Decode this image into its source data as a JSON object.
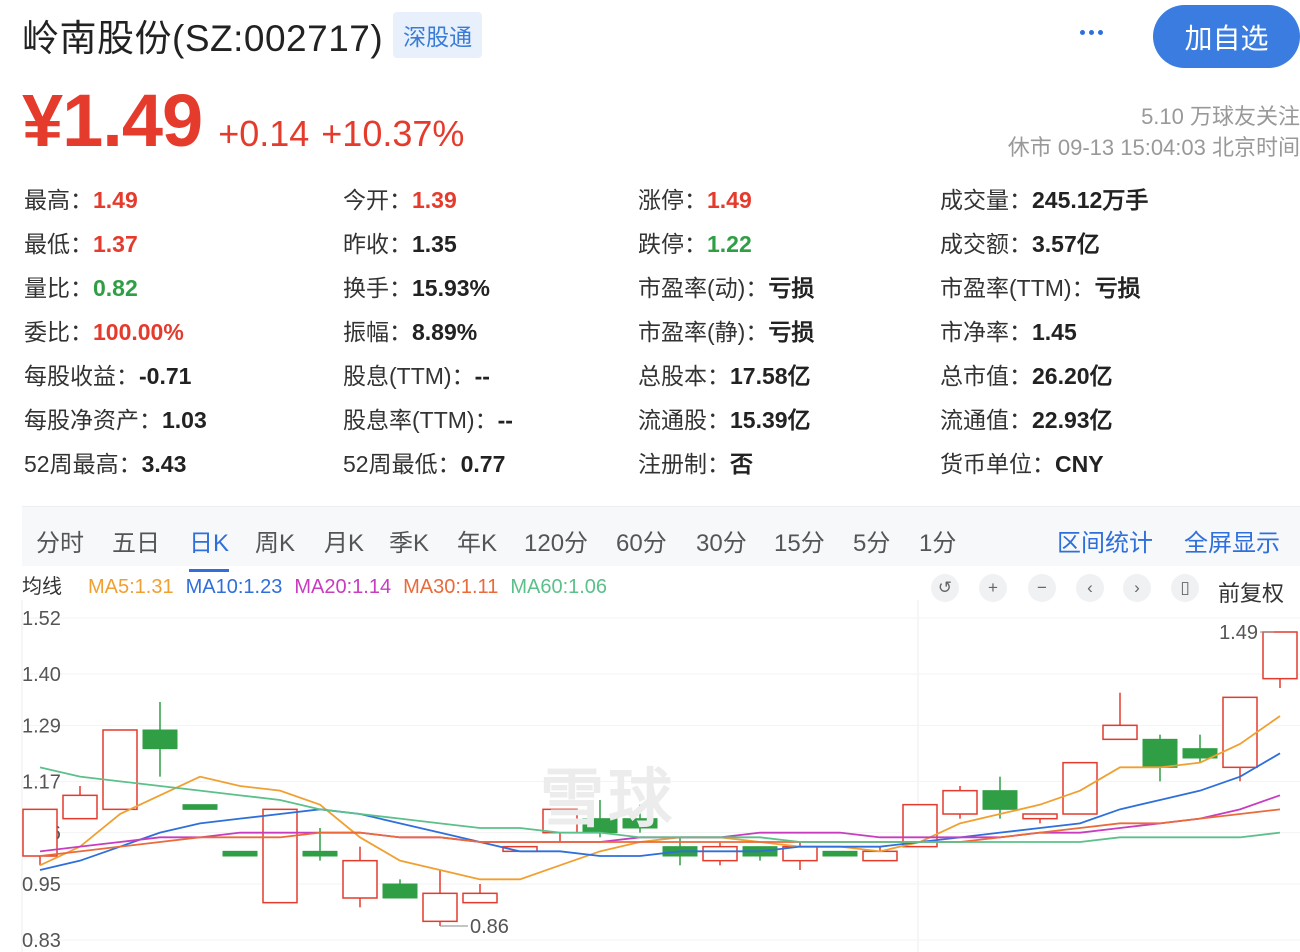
{
  "header": {
    "title": "岭南股份(SZ:002717)",
    "tag": "深股通",
    "follow_label": "加自选"
  },
  "quote": {
    "price": "¥1.49",
    "change": "+0.14",
    "change_pct": "+10.37%",
    "followers": "5.10 万球友关注",
    "status": "休市 09-13 15:04:03 北京时间"
  },
  "stats": [
    [
      {
        "k": "最高：",
        "v": "1.49",
        "c": "red"
      },
      {
        "k": "今开：",
        "v": "1.39",
        "c": "red"
      },
      {
        "k": "涨停：",
        "v": "1.49",
        "c": "red"
      },
      {
        "k": "成交量：",
        "v": "245.12万手",
        "c": "dark"
      }
    ],
    [
      {
        "k": "最低：",
        "v": "1.37",
        "c": "red"
      },
      {
        "k": "昨收：",
        "v": "1.35",
        "c": "dark"
      },
      {
        "k": "跌停：",
        "v": "1.22",
        "c": "green"
      },
      {
        "k": "成交额：",
        "v": "3.57亿",
        "c": "dark"
      }
    ],
    [
      {
        "k": "量比：",
        "v": "0.82",
        "c": "green"
      },
      {
        "k": "换手：",
        "v": "15.93%",
        "c": "dark"
      },
      {
        "k": "市盈率(动)：",
        "v": "亏损",
        "c": "dark"
      },
      {
        "k": "市盈率(TTM)：",
        "v": "亏损",
        "c": "dark"
      }
    ],
    [
      {
        "k": "委比：",
        "v": "100.00%",
        "c": "red"
      },
      {
        "k": "振幅：",
        "v": "8.89%",
        "c": "dark"
      },
      {
        "k": "市盈率(静)：",
        "v": "亏损",
        "c": "dark"
      },
      {
        "k": "市净率：",
        "v": "1.45",
        "c": "dark"
      }
    ],
    [
      {
        "k": "每股收益：",
        "v": "-0.71",
        "c": "dark"
      },
      {
        "k": "股息(TTM)：",
        "v": "--",
        "c": "dark"
      },
      {
        "k": "总股本：",
        "v": "17.58亿",
        "c": "dark"
      },
      {
        "k": "总市值：",
        "v": "26.20亿",
        "c": "dark"
      }
    ],
    [
      {
        "k": "每股净资产：",
        "v": "1.03",
        "c": "dark"
      },
      {
        "k": "股息率(TTM)：",
        "v": "--",
        "c": "dark"
      },
      {
        "k": "流通股：",
        "v": "15.39亿",
        "c": "dark"
      },
      {
        "k": "流通值：",
        "v": "22.93亿",
        "c": "dark"
      }
    ],
    [
      {
        "k": "52周最高：",
        "v": "3.43",
        "c": "dark"
      },
      {
        "k": "52周最低：",
        "v": "0.77",
        "c": "dark"
      },
      {
        "k": "注册制：",
        "v": "否",
        "c": "dark"
      },
      {
        "k": "货币单位：",
        "v": "CNY",
        "c": "dark"
      }
    ]
  ],
  "tabs": [
    "分时",
    "五日",
    "日K",
    "周K",
    "月K",
    "季K",
    "年K",
    "120分",
    "60分",
    "30分",
    "15分",
    "5分",
    "1分"
  ],
  "active_tab": "日K",
  "tab_links": [
    "区间统计",
    "全屏显示"
  ],
  "ma_legend": {
    "label": "均线",
    "items": [
      {
        "text": "MA5:1.31",
        "color": "#f0a030"
      },
      {
        "text": "MA10:1.23",
        "color": "#2f6fdb"
      },
      {
        "text": "MA20:1.14",
        "color": "#c83cc0"
      },
      {
        "text": "MA30:1.11",
        "color": "#ea6a3a"
      },
      {
        "text": "MA60:1.06",
        "color": "#5cc08a"
      }
    ]
  },
  "controls": {
    "icons": [
      {
        "name": "undo-icon",
        "glyph": "↺"
      },
      {
        "name": "zoom-in-icon",
        "glyph": "+"
      },
      {
        "name": "zoom-out-icon",
        "glyph": "−"
      },
      {
        "name": "scroll-left-icon",
        "glyph": "‹"
      },
      {
        "name": "scroll-right-icon",
        "glyph": "›"
      },
      {
        "name": "candle-style-icon",
        "glyph": "▯"
      }
    ],
    "adjust_label": "前复权"
  },
  "chart_data": {
    "type": "candlestick",
    "watermark": "雪球",
    "ylim": [
      0.83,
      1.52
    ],
    "yticks": [
      1.52,
      1.4,
      1.29,
      1.17,
      1.06,
      0.95,
      0.83
    ],
    "ytick_labels": [
      "1.52",
      "1.40",
      "1.29",
      "1.17",
      "1.06",
      "0.95",
      "0.83"
    ],
    "max_label": "1.49",
    "min_label": "0.86",
    "up_color": "#e43b2d",
    "down_color": "#2f9e44",
    "candles": [
      {
        "o": 1.01,
        "h": 1.11,
        "l": 0.99,
        "c": 1.11
      },
      {
        "o": 1.09,
        "h": 1.16,
        "l": 1.09,
        "c": 1.14
      },
      {
        "o": 1.11,
        "h": 1.28,
        "l": 1.11,
        "c": 1.28
      },
      {
        "o": 1.28,
        "h": 1.34,
        "l": 1.18,
        "c": 1.24
      },
      {
        "o": 1.12,
        "h": 1.12,
        "l": 1.11,
        "c": 1.11
      },
      {
        "o": 1.02,
        "h": 1.02,
        "l": 1.01,
        "c": 1.01
      },
      {
        "o": 0.91,
        "h": 1.11,
        "l": 0.91,
        "c": 1.11
      },
      {
        "o": 1.02,
        "h": 1.07,
        "l": 1.0,
        "c": 1.01
      },
      {
        "o": 0.92,
        "h": 1.03,
        "l": 0.9,
        "c": 1.0
      },
      {
        "o": 0.95,
        "h": 0.96,
        "l": 0.92,
        "c": 0.92
      },
      {
        "o": 0.87,
        "h": 0.98,
        "l": 0.86,
        "c": 0.93
      },
      {
        "o": 0.91,
        "h": 0.95,
        "l": 0.91,
        "c": 0.93
      },
      {
        "o": 1.02,
        "h": 1.03,
        "l": 1.02,
        "c": 1.03
      },
      {
        "o": 1.06,
        "h": 1.11,
        "l": 1.04,
        "c": 1.11
      },
      {
        "o": 1.09,
        "h": 1.13,
        "l": 1.05,
        "c": 1.06
      },
      {
        "o": 1.09,
        "h": 1.12,
        "l": 1.06,
        "c": 1.07
      },
      {
        "o": 1.03,
        "h": 1.05,
        "l": 0.99,
        "c": 1.01
      },
      {
        "o": 1.0,
        "h": 1.04,
        "l": 0.99,
        "c": 1.03
      },
      {
        "o": 1.03,
        "h": 1.03,
        "l": 1.0,
        "c": 1.01
      },
      {
        "o": 1.0,
        "h": 1.04,
        "l": 0.98,
        "c": 1.03
      },
      {
        "o": 1.02,
        "h": 1.02,
        "l": 1.01,
        "c": 1.01
      },
      {
        "o": 1.0,
        "h": 1.03,
        "l": 1.0,
        "c": 1.02
      },
      {
        "o": 1.03,
        "h": 1.12,
        "l": 1.03,
        "c": 1.12
      },
      {
        "o": 1.1,
        "h": 1.16,
        "l": 1.09,
        "c": 1.15
      },
      {
        "o": 1.15,
        "h": 1.18,
        "l": 1.09,
        "c": 1.11
      },
      {
        "o": 1.09,
        "h": 1.1,
        "l": 1.08,
        "c": 1.1
      },
      {
        "o": 1.1,
        "h": 1.21,
        "l": 1.1,
        "c": 1.21
      },
      {
        "o": 1.26,
        "h": 1.36,
        "l": 1.26,
        "c": 1.29
      },
      {
        "o": 1.26,
        "h": 1.27,
        "l": 1.17,
        "c": 1.2
      },
      {
        "o": 1.24,
        "h": 1.27,
        "l": 1.21,
        "c": 1.22
      },
      {
        "o": 1.2,
        "h": 1.35,
        "l": 1.17,
        "c": 1.35
      },
      {
        "o": 1.39,
        "h": 1.49,
        "l": 1.37,
        "c": 1.49
      }
    ],
    "ma": [
      {
        "name": "MA5",
        "color": "#f0a030",
        "values": [
          0.99,
          1.03,
          1.1,
          1.14,
          1.18,
          1.16,
          1.15,
          1.12,
          1.05,
          1.0,
          0.98,
          0.96,
          0.96,
          0.99,
          1.02,
          1.04,
          1.05,
          1.05,
          1.04,
          1.03,
          1.03,
          1.02,
          1.04,
          1.08,
          1.1,
          1.12,
          1.15,
          1.2,
          1.2,
          1.21,
          1.25,
          1.31
        ]
      },
      {
        "name": "MA10",
        "color": "#2f6fdb",
        "values": [
          0.98,
          1.0,
          1.03,
          1.06,
          1.08,
          1.09,
          1.1,
          1.11,
          1.1,
          1.08,
          1.06,
          1.04,
          1.02,
          1.02,
          1.01,
          1.01,
          1.02,
          1.02,
          1.02,
          1.03,
          1.03,
          1.03,
          1.04,
          1.05,
          1.06,
          1.07,
          1.08,
          1.11,
          1.13,
          1.15,
          1.18,
          1.23
        ]
      },
      {
        "name": "MA20",
        "color": "#c83cc0",
        "values": [
          1.02,
          1.03,
          1.04,
          1.05,
          1.05,
          1.06,
          1.06,
          1.06,
          1.06,
          1.05,
          1.05,
          1.04,
          1.04,
          1.04,
          1.04,
          1.05,
          1.05,
          1.05,
          1.06,
          1.06,
          1.06,
          1.05,
          1.05,
          1.05,
          1.05,
          1.06,
          1.06,
          1.07,
          1.08,
          1.09,
          1.11,
          1.14
        ]
      },
      {
        "name": "MA30",
        "color": "#ea6a3a",
        "values": [
          1.01,
          1.02,
          1.03,
          1.04,
          1.05,
          1.05,
          1.05,
          1.06,
          1.06,
          1.05,
          1.05,
          1.04,
          1.04,
          1.04,
          1.04,
          1.04,
          1.04,
          1.04,
          1.04,
          1.04,
          1.04,
          1.04,
          1.04,
          1.04,
          1.05,
          1.06,
          1.07,
          1.08,
          1.08,
          1.09,
          1.1,
          1.11
        ]
      },
      {
        "name": "MA60",
        "color": "#5cc08a",
        "values": [
          1.2,
          1.18,
          1.17,
          1.16,
          1.15,
          1.14,
          1.13,
          1.11,
          1.1,
          1.09,
          1.08,
          1.07,
          1.07,
          1.06,
          1.06,
          1.05,
          1.05,
          1.05,
          1.05,
          1.04,
          1.04,
          1.04,
          1.04,
          1.04,
          1.04,
          1.04,
          1.04,
          1.05,
          1.05,
          1.05,
          1.05,
          1.06
        ]
      }
    ]
  }
}
